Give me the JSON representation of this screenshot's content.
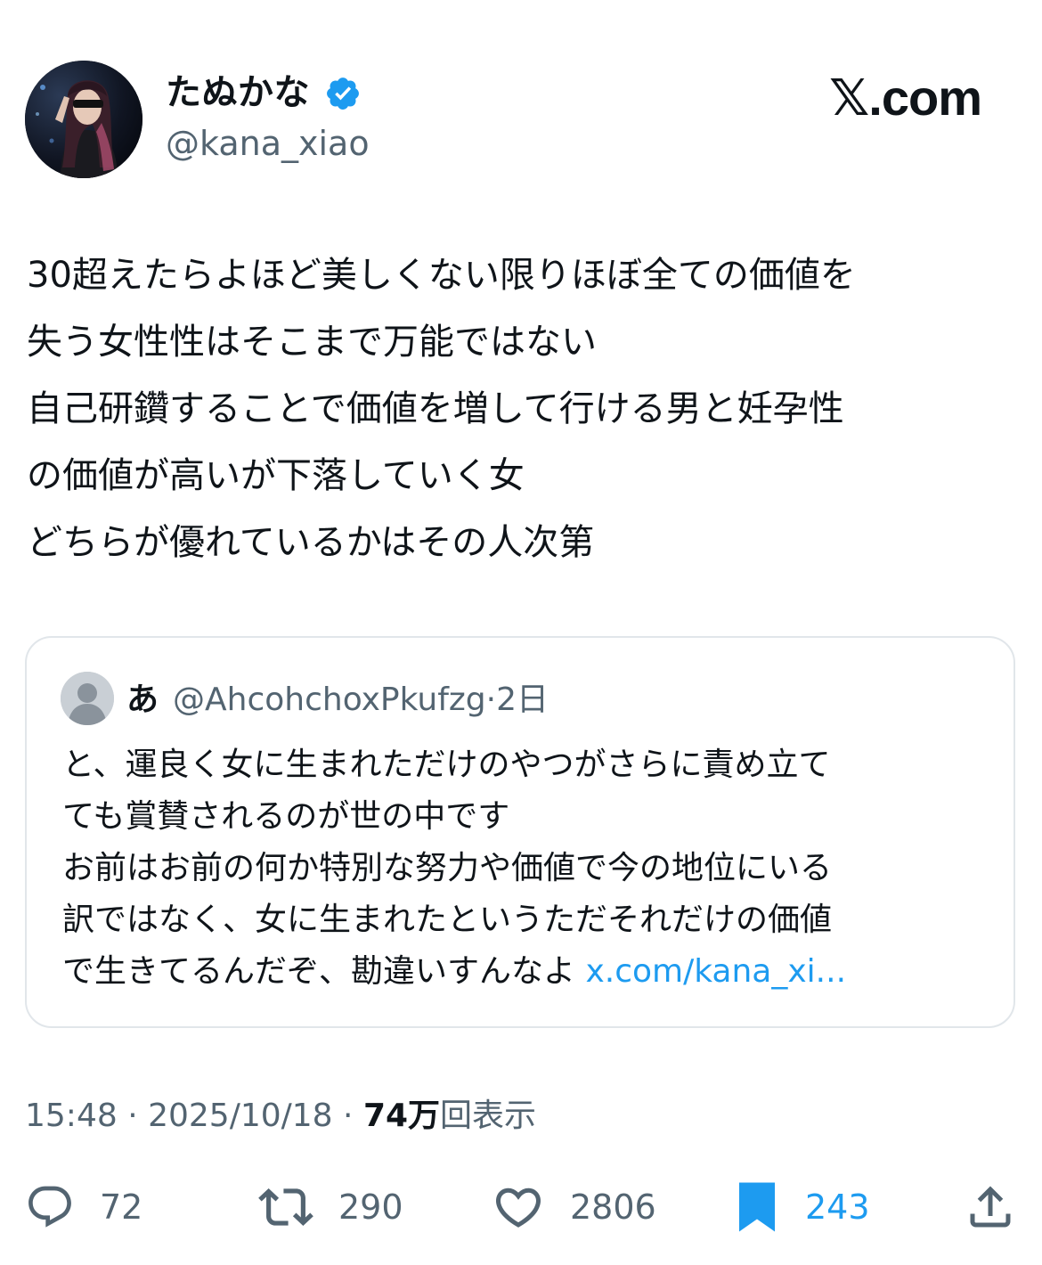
{
  "author": {
    "display_name": "たぬかな",
    "handle": "@kana_xiao",
    "verified_icon": "verified-badge-icon"
  },
  "brand": "𝕏.com",
  "tweet": {
    "lines": [
      "30超えたらよほど美しくない限りほぼ全ての価値を",
      "失う女性性はそこまで万能ではない",
      "自己研鑽することで価値を増して行ける男と妊孕性",
      "の価値が高いが下落していく女",
      "どちらが優れているかはその人次第"
    ]
  },
  "quote": {
    "name": "あ",
    "handle": "@AhcohchoxPkufzg",
    "separator": "·",
    "time": "2日",
    "lines": [
      "と、運良く女に生まれただけのやつがさらに責め立て",
      "ても賞賛されるのが世の中です",
      "お前はお前の何か特別な努力や価値で今の地位にいる",
      "訳ではなく、女に生まれたというただそれだけの価値"
    ],
    "last_line_text": "で生きてるんだぞ、勘違いすんなよ ",
    "link_text": "x.com/kana_xi..."
  },
  "meta": {
    "time": "15:48",
    "sep1": " · ",
    "date": "2025/10/18",
    "sep2": " · ",
    "views_count": "74万",
    "views_label": "回表示"
  },
  "actions": {
    "replies": "72",
    "retweets": "290",
    "likes": "2806",
    "bookmarks": "243"
  },
  "colors": {
    "text": "#0f1419",
    "secondary": "#536471",
    "accent": "#1d9bf0",
    "border": "#e1e6ea"
  }
}
